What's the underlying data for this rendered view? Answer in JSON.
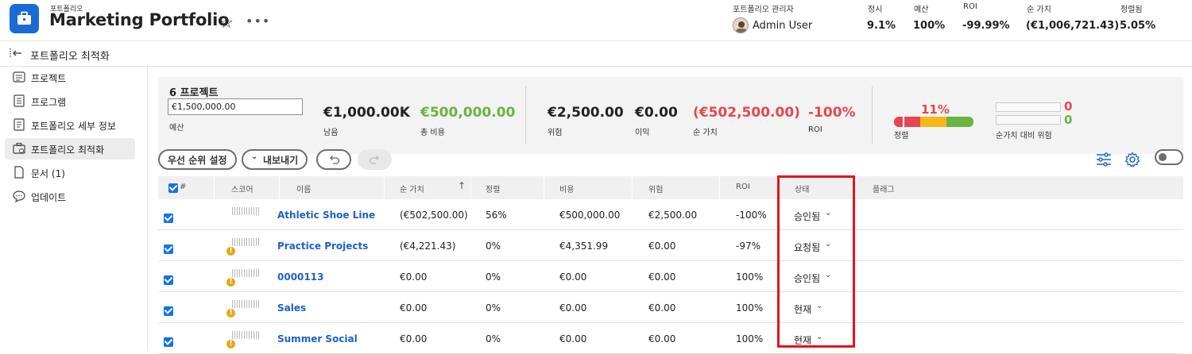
{
  "header": {
    "breadcrumb": "포트폴리오",
    "title": "Marketing Portfolio",
    "manager_label": "포트폴리오 관리자",
    "manager_name": "Admin User",
    "metrics": [
      {
        "label": "정시",
        "value": "9.1%"
      },
      {
        "label": "예산",
        "value": "100%"
      },
      {
        "label": "ROI",
        "value": "-99.99%"
      },
      {
        "label": "순 가치",
        "value": "(€1,006,721.43)"
      },
      {
        "label": "정렬됨",
        "value": "5.05%"
      }
    ]
  },
  "subheader": {
    "back_icon": "collapse-left-icon",
    "label": "포트폴리오 최적화"
  },
  "sidebar": {
    "items": [
      {
        "label": "프로젝트",
        "icon": "project-list-icon"
      },
      {
        "label": "프로그램",
        "icon": "program-icon"
      },
      {
        "label": "포트폴리오 세부 정보",
        "icon": "details-icon"
      },
      {
        "label": "포트폴리오 최적화",
        "icon": "optimize-icon",
        "active": true
      },
      {
        "label": "문서 (1)",
        "icon": "document-icon"
      },
      {
        "label": "업데이트",
        "icon": "comment-icon"
      }
    ]
  },
  "summary": {
    "project_count": "6 프로젝트",
    "budget_value": "€1,500,000.00",
    "budget_label": "예산",
    "remaining_value": "€1,000.00K",
    "remaining_label": "남음",
    "total_cost_value": "€500,000.00",
    "total_cost_label": "총 비용",
    "risk_value": "€2,500.00",
    "risk_label": "위험",
    "profit_value": "€0.00",
    "profit_label": "이익",
    "net_value_value": "(€502,500.00)",
    "net_value_label": "순 가치",
    "roi_value": "-100%",
    "roi_label": "ROI",
    "alignment_value": "11%",
    "alignment_label": "정렬",
    "alignment_level": 0.11,
    "risk_vs_value_label": "순가치 대비 위험",
    "risk_vs_value_top": "0",
    "risk_vs_value_bottom": "0"
  },
  "toolbar": {
    "priority_button": "우선 순위 설정",
    "export_button": "내보내기",
    "colors": {
      "accent": "#1473e6",
      "red": "#e34850",
      "green": "#6cb33f"
    }
  },
  "table": {
    "headers": {
      "num": "#",
      "score": "스코어",
      "name": "이름",
      "net_value": "순 가치",
      "alignment": "정렬",
      "cost": "비용",
      "risk": "위험",
      "roi": "ROI",
      "status": "상태",
      "flag": "플래그"
    },
    "rows": [
      {
        "name": "Athletic Shoe Line",
        "net_value": "(€502,500.00)",
        "alignment": "56%",
        "cost": "€500,000.00",
        "risk": "€2,500.00",
        "roi": "-100%",
        "status": "승인됨",
        "warning": false
      },
      {
        "name": "Practice Projects",
        "net_value": "(€4,221.43)",
        "alignment": "0%",
        "cost": "€4,351.99",
        "risk": "€0.00",
        "roi": "-97%",
        "status": "요청됨",
        "warning": true
      },
      {
        "name": "0000113",
        "net_value": "€0.00",
        "alignment": "0%",
        "cost": "€0.00",
        "risk": "€0.00",
        "roi": "100%",
        "status": "승인됨",
        "warning": true
      },
      {
        "name": "Sales",
        "net_value": "€0.00",
        "alignment": "0%",
        "cost": "€0.00",
        "risk": "€0.00",
        "roi": "100%",
        "status": "현재",
        "warning": true
      },
      {
        "name": "Summer Social",
        "net_value": "€0.00",
        "alignment": "0%",
        "cost": "€0.00",
        "risk": "€0.00",
        "roi": "100%",
        "status": "현재",
        "warning": true
      }
    ]
  }
}
